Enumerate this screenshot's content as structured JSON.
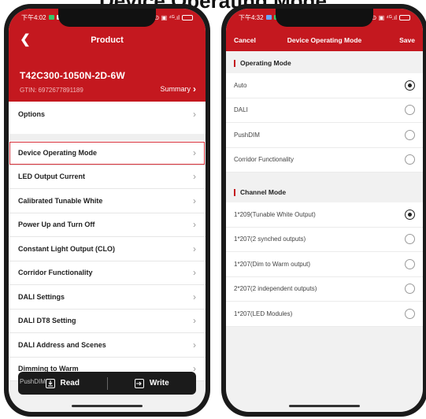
{
  "doc_heading": "Device Operating Mode",
  "left_phone": {
    "status": {
      "time": "下午4:02",
      "signal": "⊙ ▣ ⁴ᴳ.ıl",
      "battery": ""
    },
    "nav_title": "Product",
    "back_icon": "chevron-left-icon",
    "product_name": "T42C300-1050N-2D-6W",
    "gtin": "GTIN: 6972677891189",
    "summary_label": "Summary",
    "rows": [
      {
        "label": "Options"
      },
      {
        "label": "Device Operating Mode"
      },
      {
        "label": "LED Output Current"
      },
      {
        "label": "Calibrated Tunable White"
      },
      {
        "label": "Power Up and Turn Off"
      },
      {
        "label": "Constant Light Output (CLO)"
      },
      {
        "label": "Corridor Functionality"
      },
      {
        "label": "DALI Settings"
      },
      {
        "label": "DALI DT8 Setting"
      },
      {
        "label": "DALI Address and Scenes"
      },
      {
        "label": "Dimming to Warm"
      }
    ],
    "ghost_text": "PushDIM",
    "read_label": "Read",
    "write_label": "Write"
  },
  "right_phone": {
    "status": {
      "time": "下午4:32",
      "signal": "⊙ ▣ ⁴ᴳ.ıl",
      "battery": ""
    },
    "cancel_label": "Cancel",
    "title": "Device Operating Mode",
    "save_label": "Save",
    "operating_mode": {
      "heading": "Operating Mode",
      "options": [
        {
          "label": "Auto",
          "selected": true
        },
        {
          "label": "DALI",
          "selected": false
        },
        {
          "label": "PushDIM",
          "selected": false
        },
        {
          "label": "Corridor Functionality",
          "selected": false
        }
      ]
    },
    "channel_mode": {
      "heading": "Channel Mode",
      "options": [
        {
          "label": "1*209(Tunable White Output)",
          "selected": true
        },
        {
          "label": "1*207(2 synched outputs)",
          "selected": false
        },
        {
          "label": "1*207(Dim to Warm output)",
          "selected": false
        },
        {
          "label": "2*207(2 independent outputs)",
          "selected": false
        },
        {
          "label": "1*207(LED Modules)",
          "selected": false
        }
      ]
    }
  },
  "colors": {
    "brand_red": "#c4181f",
    "highlight_border": "#d8303a"
  }
}
